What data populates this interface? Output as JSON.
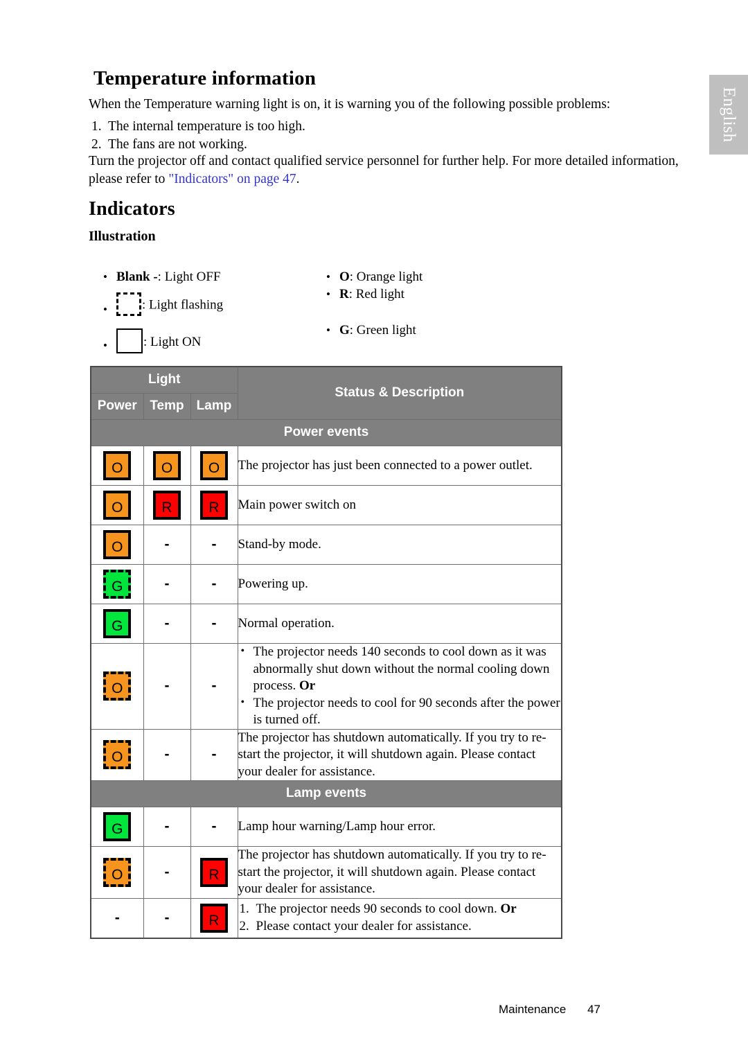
{
  "sidebar": {
    "language_tab": "English"
  },
  "temperature": {
    "heading": "Temperature information",
    "intro": "When the Temperature warning light is on, it is warning you of the following possible problems:",
    "numbered": [
      {
        "num": "1.",
        "text": "The internal temperature is too high."
      },
      {
        "num": "2.",
        "text": "The fans are not working."
      }
    ],
    "closing_before_link": "Turn the projector off and contact qualified service personnel for further help. For more detailed information, please refer to ",
    "link_text": "\"Indicators\" on page 47",
    "closing_after_link": "."
  },
  "indicators": {
    "heading": "Indicators",
    "illustration_heading": "Illustration",
    "legend_left": [
      {
        "prefix_bold": "Blank -",
        "suffix": ": Light OFF",
        "icon": "none"
      },
      {
        "prefix_bold": "",
        "suffix": ": Light flashing",
        "icon": "dashed-box"
      },
      {
        "prefix_bold": "",
        "suffix": ": Light ON",
        "icon": "solid-box"
      }
    ],
    "legend_right": [
      {
        "prefix_bold": "O",
        "suffix": ": Orange light"
      },
      {
        "prefix_bold": "R",
        "suffix": ": Red light"
      },
      {
        "prefix_bold": "G",
        "suffix": ": Green light"
      }
    ]
  },
  "table": {
    "head_light": "Light",
    "head_status": "Status & Description",
    "col_power": "Power",
    "col_temp": "Temp",
    "col_lamp": "Lamp",
    "group_power_events": "Power events",
    "group_lamp_events": "Lamp events",
    "power_rows": [
      {
        "power": {
          "letter": "O",
          "color": "orange",
          "style": "solid"
        },
        "temp": {
          "letter": "O",
          "color": "orange",
          "style": "solid"
        },
        "lamp": {
          "letter": "O",
          "color": "orange",
          "style": "solid"
        },
        "desc_type": "plain",
        "desc": "The projector has just been connected to a power outlet."
      },
      {
        "power": {
          "letter": "O",
          "color": "orange",
          "style": "solid"
        },
        "temp": {
          "letter": "R",
          "color": "red",
          "style": "solid"
        },
        "lamp": {
          "letter": "R",
          "color": "red",
          "style": "solid"
        },
        "desc_type": "plain",
        "desc": "Main power switch on"
      },
      {
        "power": {
          "letter": "O",
          "color": "orange",
          "style": "solid"
        },
        "temp": {
          "letter": "-",
          "color": "none",
          "style": "dash"
        },
        "lamp": {
          "letter": "-",
          "color": "none",
          "style": "dash"
        },
        "desc_type": "plain",
        "desc": "Stand-by mode."
      },
      {
        "power": {
          "letter": "G",
          "color": "green",
          "style": "flash"
        },
        "temp": {
          "letter": "-",
          "color": "none",
          "style": "dash"
        },
        "lamp": {
          "letter": "-",
          "color": "none",
          "style": "dash"
        },
        "desc_type": "plain",
        "desc": "Powering up."
      },
      {
        "power": {
          "letter": "G",
          "color": "green",
          "style": "solid"
        },
        "temp": {
          "letter": "-",
          "color": "none",
          "style": "dash"
        },
        "lamp": {
          "letter": "-",
          "color": "none",
          "style": "dash"
        },
        "desc_type": "plain",
        "desc": "Normal operation."
      },
      {
        "power": {
          "letter": "O",
          "color": "orange",
          "style": "flash"
        },
        "temp": {
          "letter": "-",
          "color": "none",
          "style": "dash"
        },
        "lamp": {
          "letter": "-",
          "color": "none",
          "style": "dash"
        },
        "desc_type": "bullets",
        "bullets": [
          {
            "text": "The projector needs 140 seconds to cool down as it was abnormally shut down without the normal cooling down process. ",
            "bold_tail": "Or"
          },
          {
            "text": "The projector needs to cool for 90 seconds after the power is turned off.",
            "bold_tail": ""
          }
        ]
      },
      {
        "power": {
          "letter": "O",
          "color": "orange",
          "style": "flash"
        },
        "temp": {
          "letter": "-",
          "color": "none",
          "style": "dash"
        },
        "lamp": {
          "letter": "-",
          "color": "none",
          "style": "dash"
        },
        "desc_type": "plain",
        "desc": "The projector has shutdown automatically. If you try to re-start the projector, it will shutdown again. Please contact your dealer for assistance."
      }
    ],
    "lamp_rows": [
      {
        "power": {
          "letter": "G",
          "color": "green",
          "style": "solid"
        },
        "temp": {
          "letter": "-",
          "color": "none",
          "style": "dash"
        },
        "lamp": {
          "letter": "-",
          "color": "none",
          "style": "dash"
        },
        "desc_type": "plain",
        "desc": "Lamp hour warning/Lamp hour error."
      },
      {
        "power": {
          "letter": "O",
          "color": "orange",
          "style": "flash"
        },
        "temp": {
          "letter": "-",
          "color": "none",
          "style": "dash"
        },
        "lamp": {
          "letter": "R",
          "color": "red",
          "style": "solid"
        },
        "desc_type": "plain",
        "desc": "The projector has shutdown automatically. If you try to re-start the projector, it will shutdown again. Please contact your dealer for assistance."
      },
      {
        "power": {
          "letter": "-",
          "color": "none",
          "style": "dash"
        },
        "temp": {
          "letter": "-",
          "color": "none",
          "style": "dash"
        },
        "lamp": {
          "letter": "R",
          "color": "red",
          "style": "solid"
        },
        "desc_type": "numbers",
        "numbers": [
          {
            "num": "1.",
            "text": "The projector needs 90 seconds to cool down. ",
            "bold_tail": "Or"
          },
          {
            "num": "2.",
            "text": "Please contact your dealer for assistance.",
            "bold_tail": ""
          }
        ]
      }
    ]
  },
  "footer": {
    "label": "Maintenance",
    "page": "47"
  },
  "colors": {
    "orange": "#F7941D",
    "red": "#FF0000",
    "green": "#00E63C",
    "header_gray": "#808080",
    "tab_gray": "#BFBFBF",
    "link_blue": "#3333CC"
  }
}
